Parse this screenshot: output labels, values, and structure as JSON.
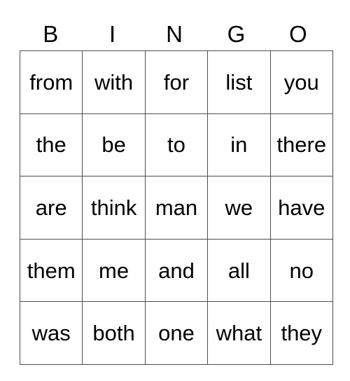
{
  "card": {
    "columns": [
      "B",
      "I",
      "N",
      "G",
      "O"
    ],
    "rows": [
      [
        "from",
        "with",
        "for",
        "list",
        "you"
      ],
      [
        "the",
        "be",
        "to",
        "in",
        "there"
      ],
      [
        "are",
        "think",
        "man",
        "we",
        "have"
      ],
      [
        "them",
        "me",
        "and",
        "all",
        "no"
      ],
      [
        "was",
        "both",
        "one",
        "what",
        "they"
      ]
    ]
  },
  "colors": {
    "text": "#000000",
    "border": "#4d4d4d",
    "background": "#ffffff"
  }
}
